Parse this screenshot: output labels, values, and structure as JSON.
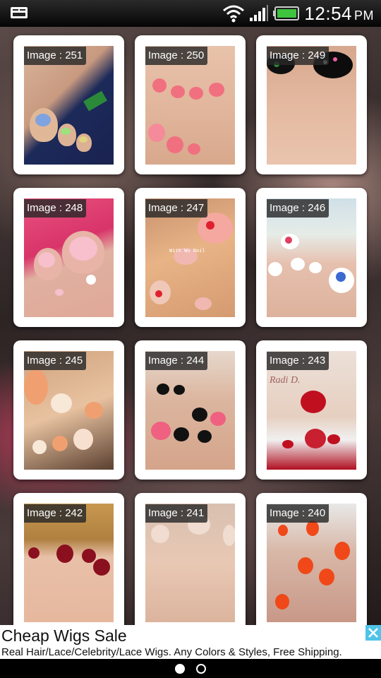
{
  "status_bar": {
    "time": "12:54",
    "ampm": "PM"
  },
  "gallery": {
    "items": [
      {
        "label": "Image : 251"
      },
      {
        "label": "Image : 250"
      },
      {
        "label": "Image : 249"
      },
      {
        "label": "Image : 248"
      },
      {
        "label": "Image : 247"
      },
      {
        "label": "Image : 246"
      },
      {
        "label": "Image : 245"
      },
      {
        "label": "Image : 244"
      },
      {
        "label": "Image : 243"
      },
      {
        "label": "Image : 242"
      },
      {
        "label": "Image : 241"
      },
      {
        "label": "Image : 240"
      }
    ],
    "photo_watermarks": {
      "img247": "With Wo Nail",
      "img243": "Radi D."
    }
  },
  "ad": {
    "title": "Cheap Wigs Sale",
    "description": "Real Hair/Lace/Celebrity/Lace Wigs. Any Colors & Styles, Free Shipping."
  },
  "pager": {
    "current_page": 1,
    "total_pages": 2
  }
}
